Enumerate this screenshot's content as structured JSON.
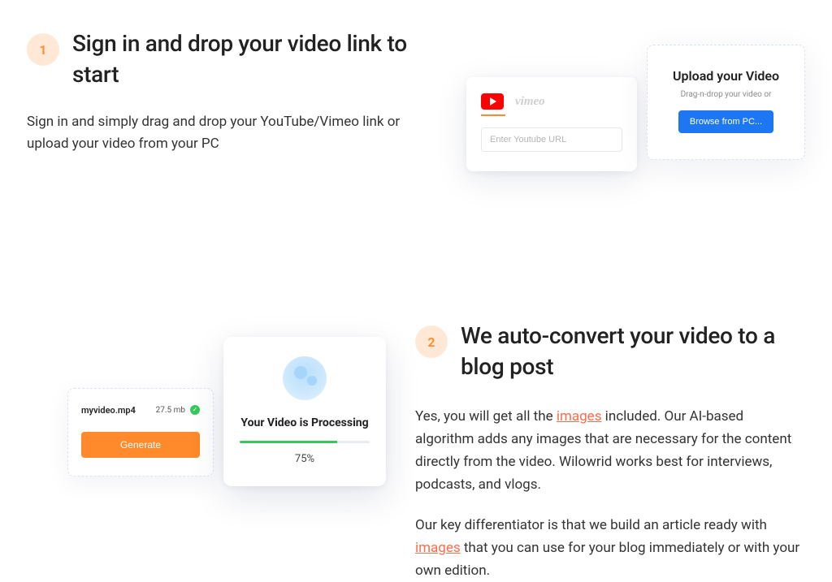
{
  "step1": {
    "num": "1",
    "title": "Sign in and drop your video link to start",
    "desc": "Sign in and simply drag and drop your YouTube/Vimeo link or upload your video from your PC",
    "vimeo_label": "vimeo",
    "url_placeholder": "Enter Youtube URL",
    "upload_title": "Upload your Video",
    "upload_sub": "Drag-n-drop your video or",
    "browse_label": "Browse from PC..."
  },
  "step2": {
    "num": "2",
    "title": "We auto-convert your video to a blog post",
    "para1_a": "Yes, you will get all the ",
    "para1_link": "images",
    "para1_b": " included. Our AI-based algorithm adds any images that are necessary for the content directly from the video. Wilowrid works best for interviews, podcasts, and vlogs.",
    "para2_a": "Our key differentiator is that we build an article ready with ",
    "para2_link": "images",
    "para2_b": " that you can use for your blog immediately or with your own edition.",
    "file_name": "myvideo.mp4",
    "file_size": "27.5 mb",
    "check_glyph": "✓",
    "generate_label": "Generate",
    "processing_title": "Your Video is Processing",
    "progress_pct": "75%",
    "progress_value": 75
  }
}
